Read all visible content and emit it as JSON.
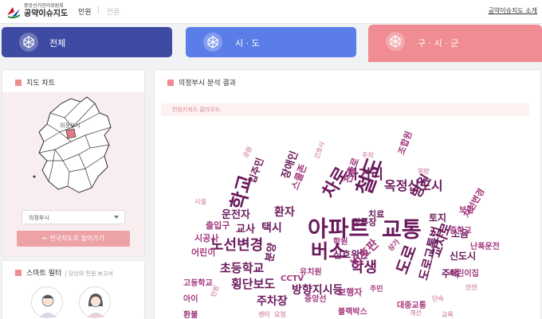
{
  "header": {
    "logo_sub": "중앙선거관리위원회",
    "logo_main": "공약이슈지도",
    "nav_civil": "민원",
    "nav_press": "언론",
    "about_link": "공약이슈지도 소개"
  },
  "tabs": [
    {
      "label": "전체"
    },
    {
      "label": "시 · 도"
    },
    {
      "label": "구 · 시 · 군"
    }
  ],
  "map_panel": {
    "title": "지도 차트",
    "selected_region": "의정부시",
    "back_button": "← 전국지도로 돌아가기"
  },
  "smart_filter": {
    "title": "스마트 필터",
    "hint": "당신의 민원 보고서"
  },
  "result": {
    "title": "의정부시 분석 결과",
    "keyword_cloud_title": "민원키워드 클라우드"
  },
  "colors": {
    "tab_all": "#3f4aa3",
    "tab_sido": "#5b7de8",
    "tab_sigungu": "#f08c93",
    "accent": "#f08c93",
    "word_dark": "#6b1a5c",
    "word_mid": "#a3397e",
    "word_light": "#d999b7"
  },
  "cloud_words": [
    {
      "t": "아파트",
      "c": "dark"
    },
    {
      "t": "교통",
      "c": "dark"
    },
    {
      "t": "버스",
      "c": "dark"
    },
    {
      "t": "노선변경",
      "c": "dark"
    },
    {
      "t": "철도",
      "c": "dark"
    },
    {
      "t": "학교",
      "c": "dark"
    },
    {
      "t": "도로",
      "c": "dark"
    },
    {
      "t": "학생",
      "c": "dark"
    },
    {
      "t": "차로",
      "c": "dark"
    },
    {
      "t": "옥정신도시",
      "c": "dark"
    },
    {
      "t": "사거리",
      "c": "dark"
    },
    {
      "t": "병원",
      "c": "dark"
    },
    {
      "t": "초등학교",
      "c": "dark"
    },
    {
      "t": "횡단보도",
      "c": "dark"
    },
    {
      "t": "주차장",
      "c": "dark"
    },
    {
      "t": "방향지시등",
      "c": "dark"
    },
    {
      "t": "도로교통법",
      "c": "dark"
    },
    {
      "t": "교차로",
      "c": "dark"
    },
    {
      "t": "주택",
      "c": "dark"
    },
    {
      "t": "신도시",
      "c": "dark"
    },
    {
      "t": "소음",
      "c": "dark"
    },
    {
      "t": "토지",
      "c": "dark"
    },
    {
      "t": "환자",
      "c": "dark"
    },
    {
      "t": "택시",
      "c": "dark"
    },
    {
      "t": "교사",
      "c": "dark"
    },
    {
      "t": "운전자",
      "c": "dark"
    },
    {
      "t": "신호위반",
      "c": "dark"
    },
    {
      "t": "분양",
      "c": "dark"
    },
    {
      "t": "정류장",
      "c": "dark"
    },
    {
      "t": "치료",
      "c": "dark"
    },
    {
      "t": "장애인",
      "c": "dark"
    },
    {
      "t": "입주민",
      "c": "dark"
    },
    {
      "t": "조합원",
      "c": "mid"
    },
    {
      "t": "차선변경",
      "c": "mid"
    },
    {
      "t": "중학교",
      "c": "mid"
    },
    {
      "t": "난폭운전",
      "c": "mid"
    },
    {
      "t": "어린이집",
      "c": "mid"
    },
    {
      "t": "보험",
      "c": "mid"
    },
    {
      "t": "번호판",
      "c": "mid"
    },
    {
      "t": "보행자",
      "c": "mid"
    },
    {
      "t": "유치원",
      "c": "mid"
    },
    {
      "t": "CCTV",
      "c": "mid"
    },
    {
      "t": "학원",
      "c": "mid"
    },
    {
      "t": "시공사",
      "c": "mid"
    },
    {
      "t": "어린이",
      "c": "mid"
    },
    {
      "t": "출입구",
      "c": "mid"
    },
    {
      "t": "고등학교",
      "c": "mid"
    },
    {
      "t": "아이",
      "c": "mid"
    },
    {
      "t": "환불",
      "c": "mid"
    },
    {
      "t": "대중교통",
      "c": "mid"
    },
    {
      "t": "진출로",
      "c": "mid"
    },
    {
      "t": "중앙선",
      "c": "mid"
    },
    {
      "t": "블랙박스",
      "c": "mid"
    },
    {
      "t": "스쿨존",
      "c": "mid"
    },
    {
      "t": "주민",
      "c": "mid"
    },
    {
      "t": "상가",
      "c": "mid"
    },
    {
      "t": "공원",
      "c": "light"
    },
    {
      "t": "간호사",
      "c": "light"
    },
    {
      "t": "주차",
      "c": "light"
    },
    {
      "t": "위반",
      "c": "light"
    },
    {
      "t": "단속",
      "c": "light"
    },
    {
      "t": "민원",
      "c": "light"
    },
    {
      "t": "교육",
      "c": "light"
    },
    {
      "t": "센터",
      "c": "light"
    },
    {
      "t": "시설",
      "c": "light"
    },
    {
      "t": "안전",
      "c": "light"
    },
    {
      "t": "개선",
      "c": "light"
    },
    {
      "t": "요청",
      "c": "light"
    }
  ]
}
